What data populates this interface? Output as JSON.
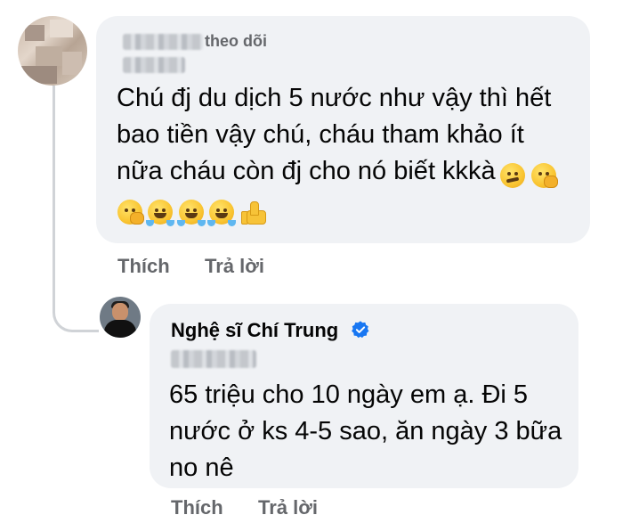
{
  "comment": {
    "follow_tag": "theo dõi",
    "text_lines": [
      "Chú đj du dịch 5 nước như vậy thì hết",
      "bao tiền vậy chú, cháu tham khảo ít",
      "nữa cháu còn đj cho nó biết kkkà"
    ],
    "line3_emojis": [
      "woozy-face",
      "face-with-hand-over-mouth"
    ],
    "emoji_row": [
      "face-with-hand-over-mouth",
      "rolling-laughing-tears",
      "rolling-laughing-tears",
      "rolling-laughing-tears",
      "thumbs-up"
    ],
    "like_label": "Thích",
    "reply_label": "Trả lời"
  },
  "reply": {
    "author": "Nghệ sĩ Chí Trung",
    "verified": true,
    "text_lines": [
      "65 triệu cho 10 ngày em ạ. Đi 5",
      "nước ở ks 4-5 sao, ăn ngày 3 bữa",
      "no nê"
    ],
    "like_label": "Thích",
    "reply_label": "Trả lời"
  },
  "colors": {
    "bubble": "#f0f2f5",
    "meta_text": "#65676b",
    "verified_blue": "#1877f2",
    "thread_line": "#d0d3d7"
  }
}
